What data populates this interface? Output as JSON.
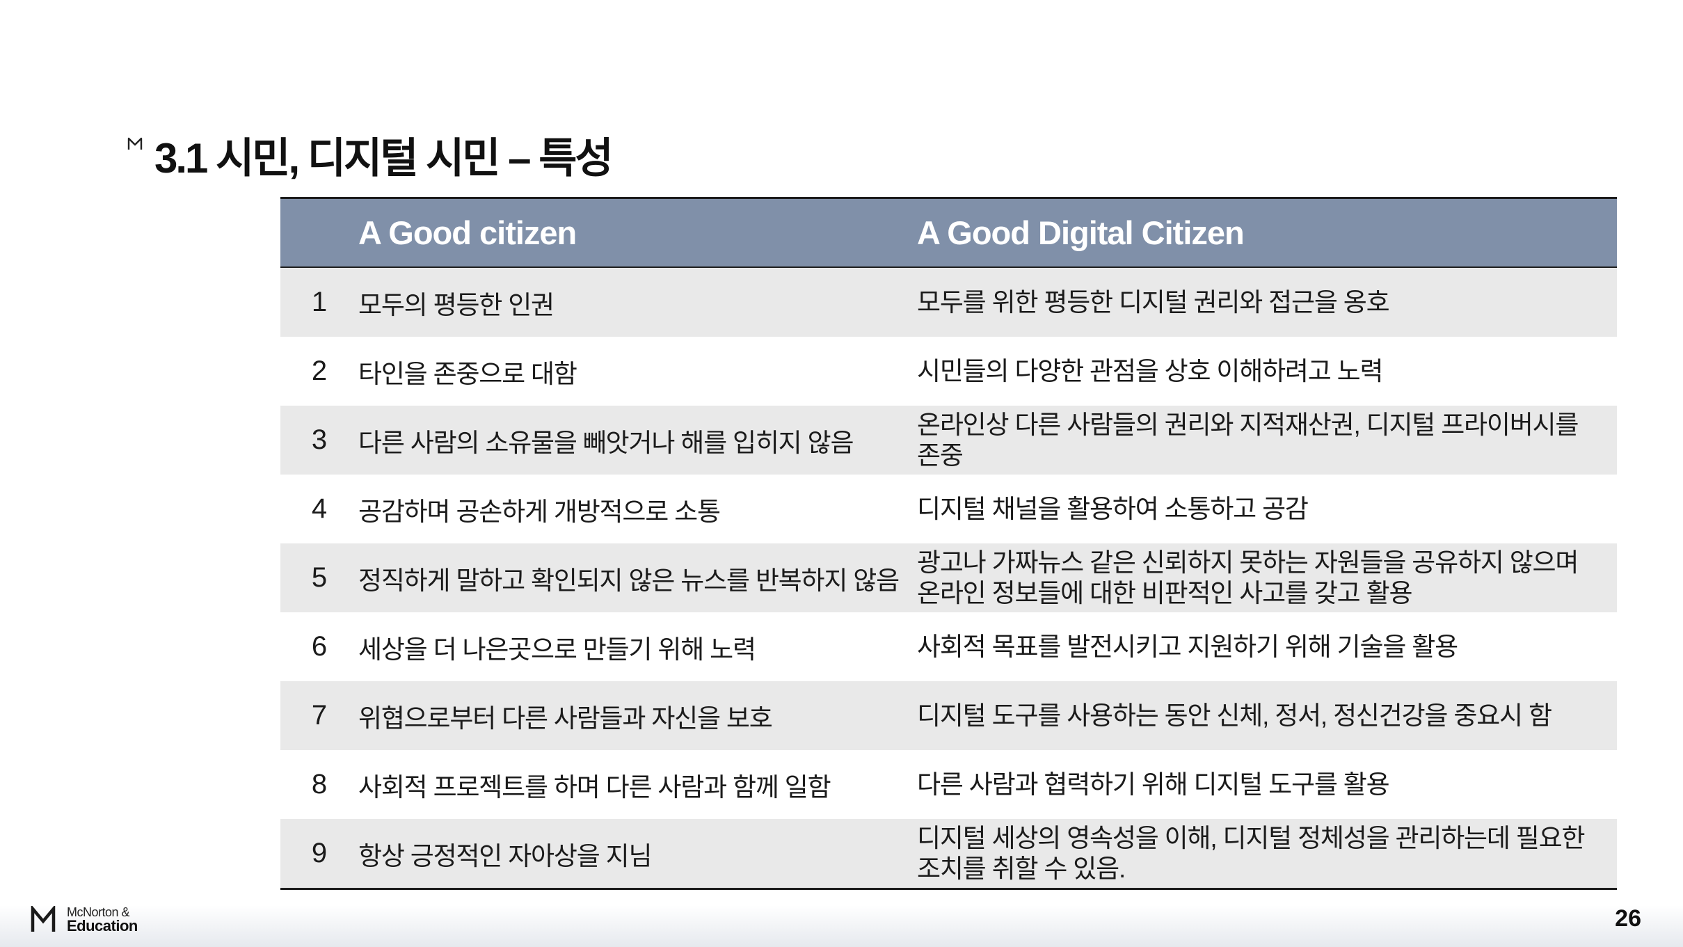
{
  "title": "3.1 시민, 디지털 시민 – 특성",
  "table": {
    "headers": [
      "A Good citizen",
      "A Good Digital Citizen"
    ],
    "rows": [
      {
        "num": "1",
        "citizen": "모두의 평등한 인권",
        "digital": "모두를 위한 평등한 디지털 권리와 접근을 옹호"
      },
      {
        "num": "2",
        "citizen": "타인을 존중으로 대함",
        "digital": "시민들의 다양한 관점을 상호 이해하려고 노력"
      },
      {
        "num": "3",
        "citizen": "다른 사람의 소유물을 빼앗거나 해를 입히지 않음",
        "digital": "온라인상 다른 사람들의 권리와 지적재산권, 디지털 프라이버시를 존중"
      },
      {
        "num": "4",
        "citizen": "공감하며 공손하게 개방적으로 소통",
        "digital": "디지털 채널을 활용하여 소통하고 공감"
      },
      {
        "num": "5",
        "citizen": "정직하게 말하고 확인되지 않은 뉴스를 반복하지 않음",
        "digital": "광고나 가짜뉴스 같은 신뢰하지 못하는 자원들을 공유하지 않으며 온라인 정보들에 대한 비판적인 사고를 갖고 활용"
      },
      {
        "num": "6",
        "citizen": "세상을 더 나은곳으로 만들기 위해 노력",
        "digital": "사회적 목표를 발전시키고 지원하기 위해 기술을 활용"
      },
      {
        "num": "7",
        "citizen": "위협으로부터 다른 사람들과 자신을 보호",
        "digital": "디지털 도구를 사용하는 동안 신체, 정서, 정신건강을 중요시 함"
      },
      {
        "num": "8",
        "citizen": "사회적 프로젝트를 하며 다른 사람과 함께 일함",
        "digital": "다른 사람과 협력하기 위해 디지털 도구를 활용"
      },
      {
        "num": "9",
        "citizen": "항상 긍정적인 자아상을 지님",
        "digital": "디지털 세상의 영속성을 이해, 디지털 정체성을 관리하는데 필요한 조치를 취할 수 있음."
      }
    ]
  },
  "footer": {
    "logo_line1": "McNorton &",
    "logo_line2": "Education",
    "page_number": "26"
  },
  "colors": {
    "header_bg": "#8090a9",
    "row_shade": "#e9e9e9"
  },
  "icons": {
    "title_mark": "mcnorton-mark-icon",
    "logo": "mcnorton-logo-icon"
  }
}
